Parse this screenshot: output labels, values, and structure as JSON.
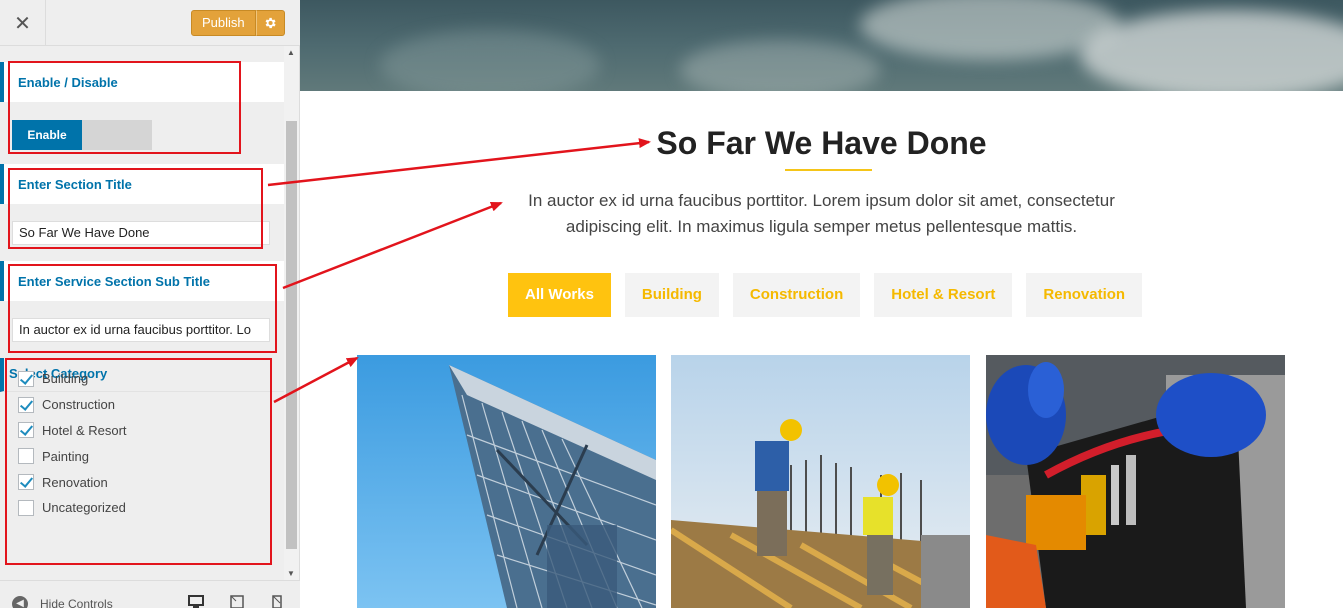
{
  "sidebar": {
    "close_icon": "close-icon",
    "publish_label": "Publish",
    "publish_settings_icon": "gear-icon",
    "enable_section": {
      "title": "Enable / Disable",
      "toggle_label": "Enable",
      "enabled": true
    },
    "section_title_control": {
      "title": "Enter Section Title",
      "value": "So Far We Have Done"
    },
    "sub_title_control": {
      "title": "Enter Service Section Sub Title",
      "value": "In auctor ex id urna faucibus porttitor. Lo"
    },
    "category_control": {
      "title": "Select Category",
      "items": [
        {
          "label": "Building",
          "checked": true
        },
        {
          "label": "Construction",
          "checked": true
        },
        {
          "label": "Hotel & Resort",
          "checked": true
        },
        {
          "label": "Painting",
          "checked": false
        },
        {
          "label": "Renovation",
          "checked": true
        },
        {
          "label": "Uncategorized",
          "checked": false
        }
      ]
    },
    "footer": {
      "hide_controls_label": "Hide Controls",
      "devices": [
        "desktop-icon",
        "tablet-icon",
        "mobile-icon"
      ]
    }
  },
  "preview": {
    "section_title": "So Far We Have Done",
    "section_subtitle": "In auctor ex id urna faucibus porttitor. Lorem ipsum dolor sit amet, consectetur adipiscing elit. In maximus ligula semper metus pellentesque mattis.",
    "filters": [
      {
        "label": "All Works",
        "active": true
      },
      {
        "label": "Building",
        "active": false
      },
      {
        "label": "Construction",
        "active": false
      },
      {
        "label": "Hotel & Resort",
        "active": false
      },
      {
        "label": "Renovation",
        "active": false
      }
    ],
    "gallery": [
      {
        "subject": "glass-steel-building-photo"
      },
      {
        "subject": "construction-workers-photo"
      },
      {
        "subject": "tool-belt-photo"
      }
    ]
  },
  "colors": {
    "accent": "#0073aa",
    "publish": "#e3a23a",
    "filter_active": "#ffc30f",
    "filter_text": "#f5b900",
    "annotation": "#e2141c"
  }
}
